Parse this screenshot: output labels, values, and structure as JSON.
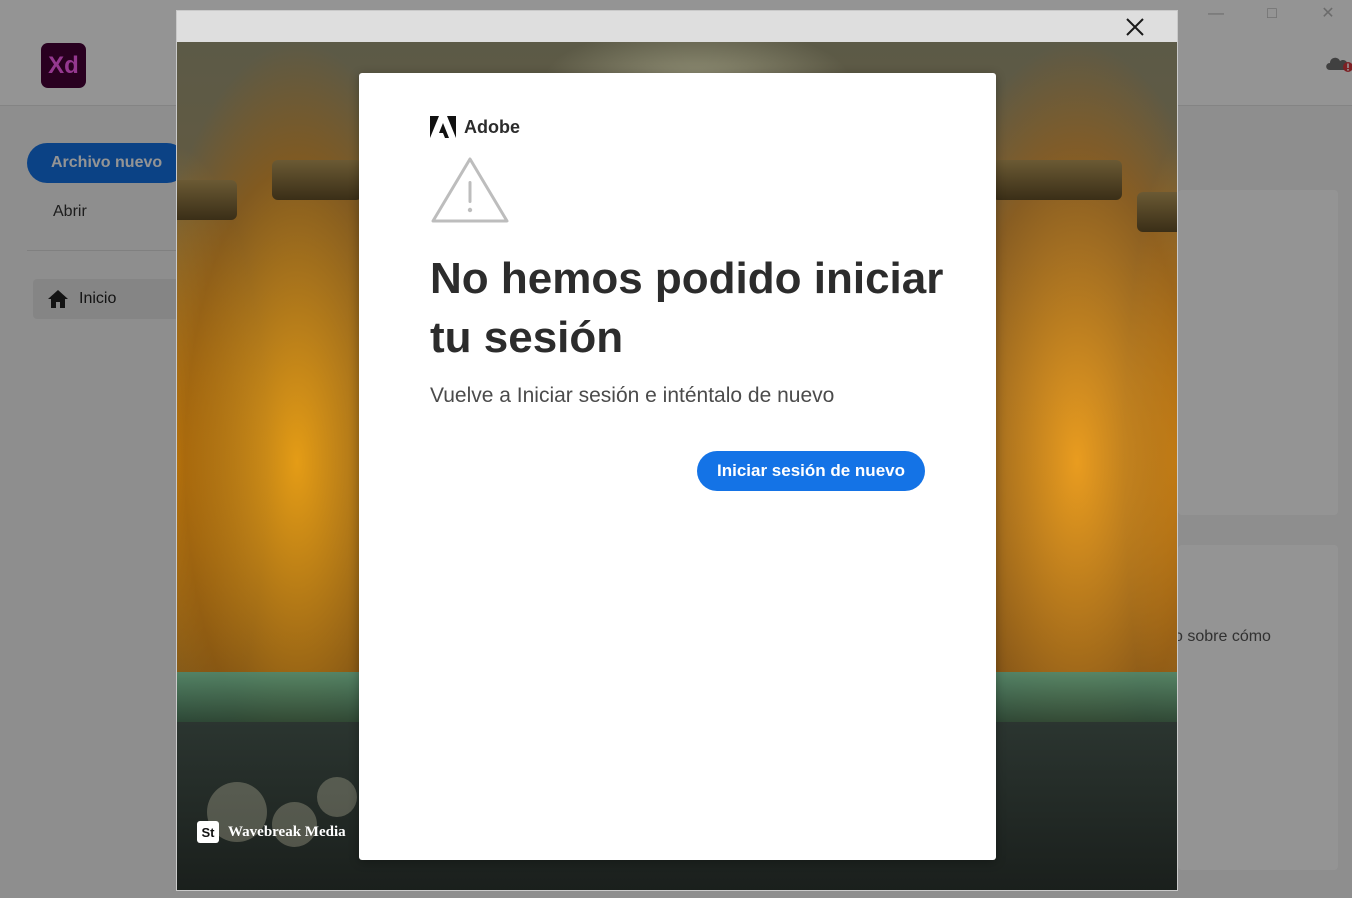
{
  "app": {
    "logo_text": "Xd",
    "new_file_label": "Archivo nuevo",
    "open_label": "Abrir",
    "home_label": "Inicio",
    "card_text_fragment": "o sobre cómo"
  },
  "modal": {
    "photo_credit": "Wavebreak Media",
    "stock_badge": "St"
  },
  "dialog": {
    "brand": "Adobe",
    "heading": "No hemos podido iniciar tu sesión",
    "subtitle": "Vuelve a Iniciar sesión e inténtalo de nuevo",
    "retry_button": "Iniciar sesión de nuevo"
  },
  "colors": {
    "accent": "#1473e6",
    "xd_bg": "#470137",
    "xd_fg": "#ff61f6"
  }
}
